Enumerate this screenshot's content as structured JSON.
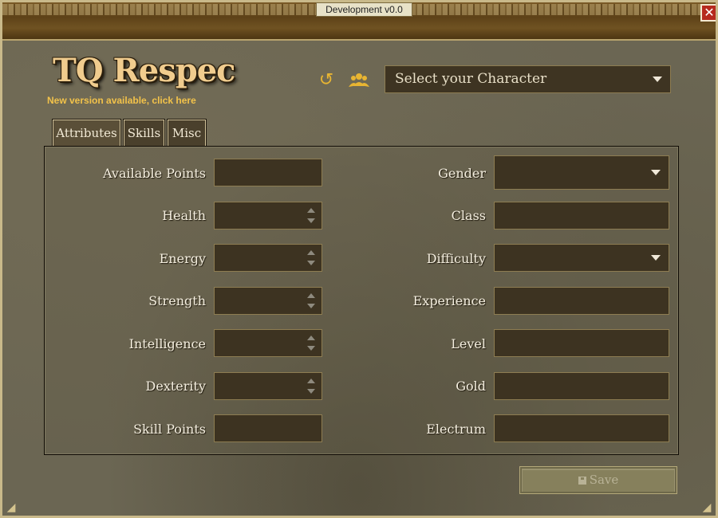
{
  "window": {
    "title": "Development v0.0",
    "close_glyph": "✕"
  },
  "header": {
    "logo": "TQ Respec",
    "update_link": "New version available, click here",
    "undo_icon": "refresh-icon",
    "users_icon": "users-icon",
    "character_select": {
      "value": "Select your Character"
    }
  },
  "tabs": [
    {
      "label": "Attributes",
      "active": true
    },
    {
      "label": "Skills",
      "active": false
    },
    {
      "label": "Misc",
      "active": false
    }
  ],
  "attributes": {
    "labels": {
      "available_points": "Available Points",
      "health": "Health",
      "energy": "Energy",
      "strength": "Strength",
      "intelligence": "Intelligence",
      "dexterity": "Dexterity",
      "skill_points": "Skill Points"
    },
    "values": {
      "available_points": "",
      "health": "",
      "energy": "",
      "strength": "",
      "intelligence": "",
      "dexterity": "",
      "skill_points": ""
    }
  },
  "character": {
    "labels": {
      "gender": "Gender",
      "class": "Class",
      "difficulty": "Difficulty",
      "experience": "Experience",
      "level": "Level",
      "gold": "Gold",
      "electrum": "Electrum"
    },
    "values": {
      "gender": "",
      "class": "",
      "difficulty": "",
      "experience": "",
      "level": "",
      "gold": "",
      "electrum": ""
    }
  },
  "footer": {
    "save_label": "Save",
    "save_enabled": false
  },
  "colors": {
    "accent": "#f0cc8e",
    "link": "#f2c24a",
    "field_bg": "#3d3321",
    "field_border": "#8e7d52",
    "close": "#b62a1e"
  }
}
